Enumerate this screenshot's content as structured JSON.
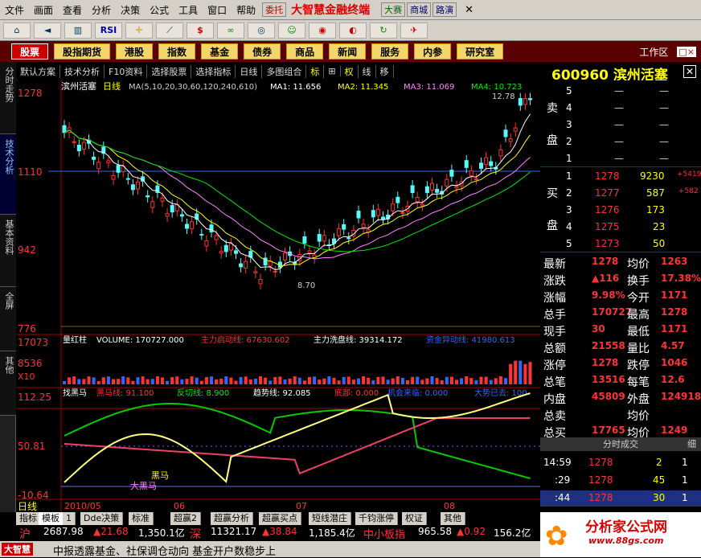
{
  "menu": {
    "items": [
      "文件",
      "画面",
      "查看",
      "分析",
      "决策",
      "公式",
      "工具",
      "窗口",
      "帮助"
    ],
    "brand": "大智慧金融终端",
    "tags": [
      "委托",
      "大赛",
      "商城",
      "路演"
    ]
  },
  "toolbar": {
    "icons": [
      "home",
      "back",
      "kline",
      "RSI",
      "cross",
      "ruler",
      "dollar",
      "link",
      "binoculars",
      "user",
      "target",
      "eye",
      "refresh",
      "plane"
    ],
    "rsi_label": "RSI"
  },
  "tabs": {
    "items": [
      "股票",
      "股指期货",
      "港股",
      "指数",
      "基金",
      "债券",
      "商品",
      "新闻",
      "服务",
      "内参",
      "研究室"
    ],
    "active": 0,
    "workarea": "工作区",
    "win_controls": "□×"
  },
  "sidebar": {
    "items": [
      "分时走势",
      "技术分析",
      "基本资料",
      "全屏",
      "其他"
    ],
    "active": 1
  },
  "subtool": {
    "items": [
      "默认方案",
      "技术分析",
      "F10资料",
      "选择股票",
      "选择指标",
      "日线",
      "多图组合",
      "标",
      "权",
      "线",
      "移"
    ]
  },
  "stock": {
    "code": "600960",
    "name": "滨州活塞"
  },
  "main_chart": {
    "title": "滨州活塞",
    "period": "日线",
    "ma_line": "MA(5,10,20,30,60,120,240,610)",
    "ma1": "MA1: 11.656",
    "ma2": "MA2: 11.345",
    "ma3": "MA3: 11.069",
    "ma4": "MA4: 10.723",
    "y_high": "1278",
    "y_mid": "1110",
    "y_low": "942",
    "y_bottom": "776",
    "label_low": "8.70",
    "label_high": "12.78",
    "colors": {
      "up": "#ff3232",
      "down": "#54fcfc",
      "ma1": "#ffffff",
      "ma2": "#ffff00",
      "ma3": "#ff80ff",
      "ma4": "#00e600"
    }
  },
  "volume_chart": {
    "name": "量红柱",
    "volume": "VOLUME: 170727.000",
    "main_in": "主力启动线: 67630.602",
    "main_wash": "主力洗盘线: 39314.172",
    "capital": "资金异动线: 41980.613",
    "y_top": "17073",
    "y_mid": "8536",
    "unit": "X10"
  },
  "indicator": {
    "name": "找黑马",
    "heima": "黑马线: 91.100",
    "fanqie": "反切线: 8.900",
    "trend": "趋势线: 92.085",
    "bottom": "底部: 0.000",
    "chance": "机会来临: 0.000",
    "big": "大势已去: 100",
    "y_top": "112.25",
    "y_mid": "50.81",
    "y_low": "-10.64",
    "label1": "黑马",
    "label2": "大黑马"
  },
  "chart_data": {
    "type": "candlestick",
    "time_labels": [
      "2010/05",
      "06",
      "07",
      "08"
    ]
  },
  "order_book": {
    "sell": [
      {
        "n": "5",
        "p": "—",
        "v": "—"
      },
      {
        "n": "4",
        "p": "—",
        "v": "—"
      },
      {
        "n": "3",
        "p": "—",
        "v": "—"
      },
      {
        "n": "2",
        "p": "—",
        "v": "—"
      },
      {
        "n": "1",
        "p": "—",
        "v": "—"
      }
    ],
    "buy": [
      {
        "n": "1",
        "p": "1278",
        "v": "9230",
        "c": "+5419"
      },
      {
        "n": "2",
        "p": "1277",
        "v": "587",
        "c": "+582"
      },
      {
        "n": "3",
        "p": "1276",
        "v": "173",
        "c": ""
      },
      {
        "n": "4",
        "p": "1275",
        "v": "23",
        "c": ""
      },
      {
        "n": "5",
        "p": "1273",
        "v": "50",
        "c": ""
      }
    ],
    "sell_label": [
      "卖",
      "盘"
    ],
    "buy_label": [
      "买",
      "盘"
    ]
  },
  "quote": [
    [
      "最新",
      "1278",
      "均价",
      "1263"
    ],
    [
      "涨跌",
      "▲116",
      "换手",
      "17.38%"
    ],
    [
      "涨幅",
      "9.98%",
      "今开",
      "1171"
    ],
    [
      "总手",
      "170727",
      "最高",
      "1278"
    ],
    [
      "现手",
      "30",
      "最低",
      "1171"
    ],
    [
      "总额",
      "21558",
      "量比",
      "4.57"
    ],
    [
      "涨停",
      "1278",
      "跌停",
      "1046"
    ],
    [
      "总笔",
      "13516",
      "每笔",
      "12.6"
    ],
    [
      "内盘",
      "45809",
      "外盘",
      "124918"
    ],
    [
      "总卖",
      "",
      "均价",
      ""
    ],
    [
      "总买",
      "17765",
      "均价",
      "1249"
    ]
  ],
  "ticks": {
    "title": "分时成交",
    "sub": "细",
    "rows": [
      [
        "14:59",
        "1278",
        "2",
        "1"
      ],
      [
        ":29",
        "1278",
        "45",
        "1"
      ],
      [
        ":44",
        "1278",
        "30",
        "1"
      ]
    ]
  },
  "bottom_tabs": [
    "指标",
    "模板",
    "1",
    "Dde决策",
    "标准",
    "超赢2",
    "超赢分析",
    "超赢买点",
    "短线潜庄",
    "千钧涨停",
    "权证",
    "其他"
  ],
  "status": {
    "sh": "沪",
    "sh_val": "2687.98",
    "sh_chg": "▲21.68",
    "sh_amt": "1,350.1亿",
    "sz": "深",
    "sz_val": "11321.17",
    "sz_chg": "▲38.84",
    "sz_amt": "1,185.4亿",
    "sme": "中小板指",
    "sme_val": "965.58",
    "sme_chg": "▲0.92",
    "sme_amt": "156.2亿"
  },
  "news": {
    "logo": "大智慧",
    "text": "中报透露基金、社保调仓动向 基金开户数稳步上"
  },
  "ad": {
    "name": "分析家公式网",
    "url": "www.88gs.com"
  }
}
